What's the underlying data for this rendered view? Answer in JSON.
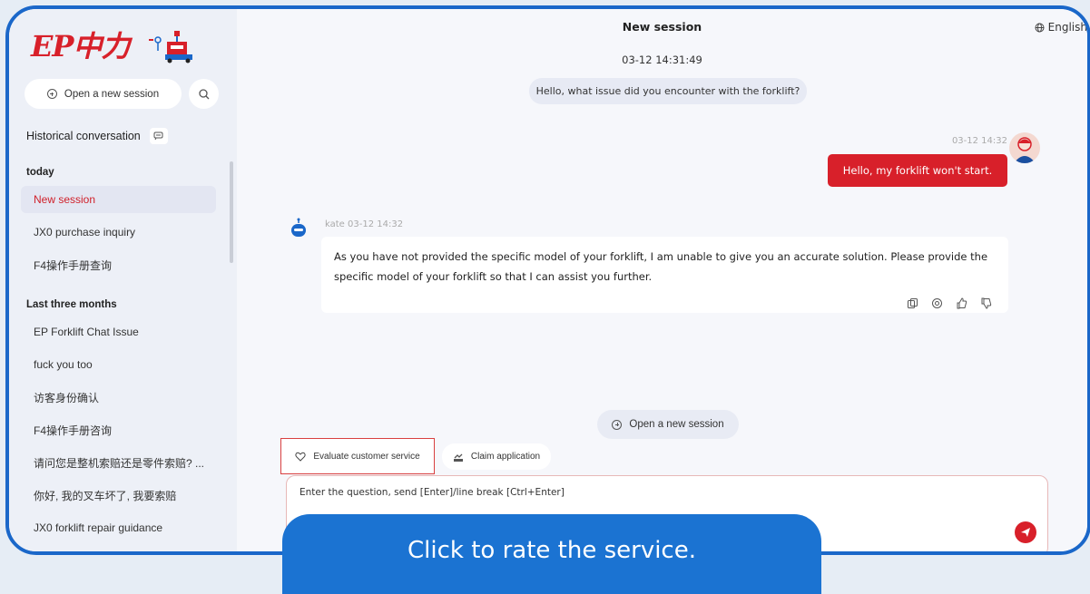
{
  "brand": {
    "logo_text": "EP中力",
    "accent": "#d8202a",
    "frame": "#1a67c9"
  },
  "sidebar": {
    "open_session_label": "Open a new session",
    "historical_label": "Historical conversation",
    "groups": [
      {
        "label": "today",
        "items": [
          "New session",
          "JX0 purchase inquiry",
          "F4操作手册查询"
        ]
      },
      {
        "label": "Last three months",
        "items": [
          "EP Forklift Chat Issue",
          "fuck you too",
          "访客身份确认",
          "F4操作手册咨询",
          "请问您是整机索赔还是零件索赔? ...",
          "你好, 我的叉车坏了, 我要索赔",
          "JX0 forklift repair guidance"
        ]
      }
    ],
    "active_item": "New session"
  },
  "header": {
    "title": "New session",
    "language": "English"
  },
  "chat": {
    "start_time": "03-12 14:31:49",
    "greeting": "Hello, what issue did you encounter with the forklift?",
    "user_time": "03-12 14:32",
    "user_message": "Hello, my forklift won't start.",
    "bot_name": "kate",
    "bot_time": "03-12 14:32",
    "bot_message": "As you have not provided the specific model of your forklift, I am unable to give you an accurate solution. Please provide the specific model of your forklift so that I can assist you further."
  },
  "actions": {
    "open_session_label": "Open a new session",
    "evaluate_label": "Evaluate customer service",
    "claim_label": "Claim application"
  },
  "input": {
    "placeholder": "Enter the question, send [Enter]/line break [Ctrl+Enter]"
  },
  "caption": "Click to rate the service."
}
